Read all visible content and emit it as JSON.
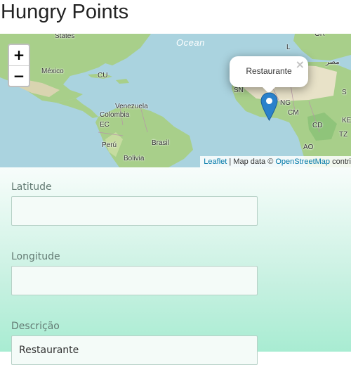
{
  "app": {
    "title": "Hungry Points"
  },
  "map": {
    "zoom_in_label": "+",
    "zoom_out_label": "−",
    "ocean_label": "Ocean",
    "places": {
      "states": "States",
      "mexico": "México",
      "cu": "CU",
      "venezuela": "Venezuela",
      "colombia": "Colombia",
      "ec": "EC",
      "peru": "Perú",
      "brasil": "Brasil",
      "bolivia": "Bolivia",
      "gr": "GR",
      "misr": "مصر",
      "sn": "SN",
      "ng": "NG",
      "cm": "CM",
      "cd": "CD",
      "ke": "KE",
      "ao": "AO",
      "tz": "TZ",
      "l": "L",
      "s": "S"
    },
    "popup": {
      "text": "Restaurante",
      "close_label": "×"
    },
    "attribution": {
      "leaflet": "Leaflet",
      "separator": " | Map data © ",
      "osm": "OpenStreetMap",
      "rest": " contri"
    },
    "colors": {
      "water": "#aad3df",
      "land": "#a8cf8a",
      "desert": "#e8e2c8",
      "marker": "#2a81cb"
    }
  },
  "form": {
    "latitude": {
      "label": "Latitude",
      "value": ""
    },
    "longitude": {
      "label": "Longitude",
      "value": ""
    },
    "description": {
      "label": "Descrição",
      "value": "Restaurante"
    }
  }
}
